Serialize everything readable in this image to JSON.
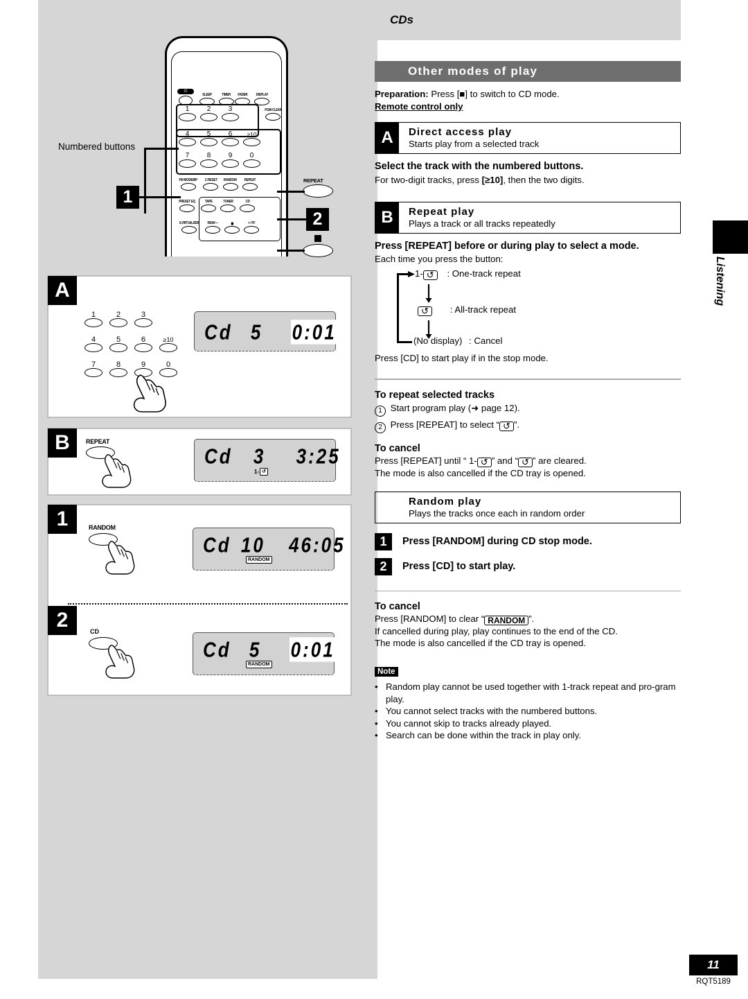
{
  "page": {
    "number": "11",
    "doc_code": "RQT5189",
    "side_tab": "Listening"
  },
  "right": {
    "category": "CDs",
    "section_title": "Other modes of play",
    "preparation_label": "Preparation:",
    "preparation_rest": " Press [",
    "preparation_rest2": "] to switch to CD mode.",
    "remote_only": "Remote control only",
    "mode_a": {
      "tag": "A",
      "title": "Direct access play",
      "sub": "Starts play from a selected track"
    },
    "a_instruction": "Select the track with the numbered buttons.",
    "a_detail_1": "For two-digit tracks, press ",
    "a_detail_bold": "[≥10]",
    "a_detail_2": ", then the two digits.",
    "mode_b": {
      "tag": "B",
      "title": "Repeat play",
      "sub": "Plays a track or all tracks repeatedly"
    },
    "b_instruction": "Press [REPEAT] before or during play to select a mode.",
    "b_each_time": "Each time you press the button:",
    "flow": {
      "step1_prefix": "1-",
      "step1_text": ": One-track repeat",
      "step2_text": ": All-track repeat",
      "step3_label": "(No display)",
      "step3_text": ": Cancel"
    },
    "b_start": "Press [CD] to start play if in the stop mode.",
    "repeat_selected": {
      "heading": "To repeat selected tracks",
      "item1_num": "1",
      "item1_text": "Start program play (➜ page 12).",
      "item2_num": "2",
      "item2_pre": "Press [REPEAT] to select “",
      "item2_post": "”."
    },
    "cancel_repeat": {
      "heading": "To cancel",
      "line1_a": "Press [REPEAT] until “ 1-",
      "line1_b": "” and “",
      "line1_c": "” are cleared.",
      "line2": "The mode is also cancelled if the CD tray is opened."
    },
    "mode_random": {
      "title": "Random play",
      "sub": "Plays the tracks once each in random order"
    },
    "random_steps": [
      {
        "num": "1",
        "text": "Press [RANDOM] during CD stop mode."
      },
      {
        "num": "2",
        "text": "Press [CD] to start play."
      }
    ],
    "cancel_random": {
      "heading": "To cancel",
      "line1_a": "Press [RANDOM] to clear “",
      "line1_badge": "RANDOM",
      "line1_b": "”.",
      "line2": "If cancelled during play, play continues to the end of the CD.",
      "line3": "The mode is also cancelled if the CD tray is opened."
    },
    "note": {
      "tag": "Note",
      "items": [
        "Random play cannot be used together with 1-track repeat and pro-gram play.",
        "You cannot select tracks with the numbered  buttons.",
        "You cannot skip to tracks already played.",
        "Search can be done within the track in play only."
      ]
    }
  },
  "left": {
    "callout_numbered_buttons": "Numbered buttons",
    "callout_1": "1",
    "callout_2": "2",
    "callout_repeat": "REPEAT",
    "remote": {
      "row_top": [
        "SLEEP",
        "TIMER",
        "FADER",
        "DISPLAY"
      ],
      "pgm_clear": "PGM/-CLEAR",
      "keypad": [
        "1",
        "2",
        "3",
        "4",
        "5",
        "6",
        "≥10",
        "7",
        "8",
        "9",
        "0"
      ],
      "row_fn": [
        "FM MODE/BP",
        "C-RESET",
        "RANDOM",
        "REPEAT"
      ],
      "row_src": [
        "PRESET EQ",
        "TAPE",
        "TUNER",
        "CD"
      ],
      "row_trans": [
        "S.VIRTUALIZER",
        "REW/—",
        "■",
        "+ / FF"
      ]
    },
    "panel_a": {
      "tag": "A",
      "keys": [
        "1",
        "2",
        "3",
        "4",
        "5",
        "6",
        "≥10",
        "7",
        "8",
        "9",
        "0"
      ],
      "lcd_main": "Cd",
      "lcd_track": "5",
      "lcd_time": "0:01"
    },
    "panel_b": {
      "tag": "B",
      "button_label": "REPEAT",
      "lcd_main": "Cd",
      "lcd_track": "3",
      "lcd_time": "3:25",
      "lcd_indicator": "1-"
    },
    "panel_1": {
      "tag": "1",
      "button_label": "RANDOM",
      "lcd_main": "Cd",
      "lcd_track": "10",
      "lcd_time": "46:05",
      "lcd_indicator": "RANDOM"
    },
    "panel_2": {
      "tag": "2",
      "button_label": "CD",
      "lcd_main": "Cd",
      "lcd_track": "5",
      "lcd_time": "0:01",
      "lcd_indicator": "RANDOM"
    }
  }
}
